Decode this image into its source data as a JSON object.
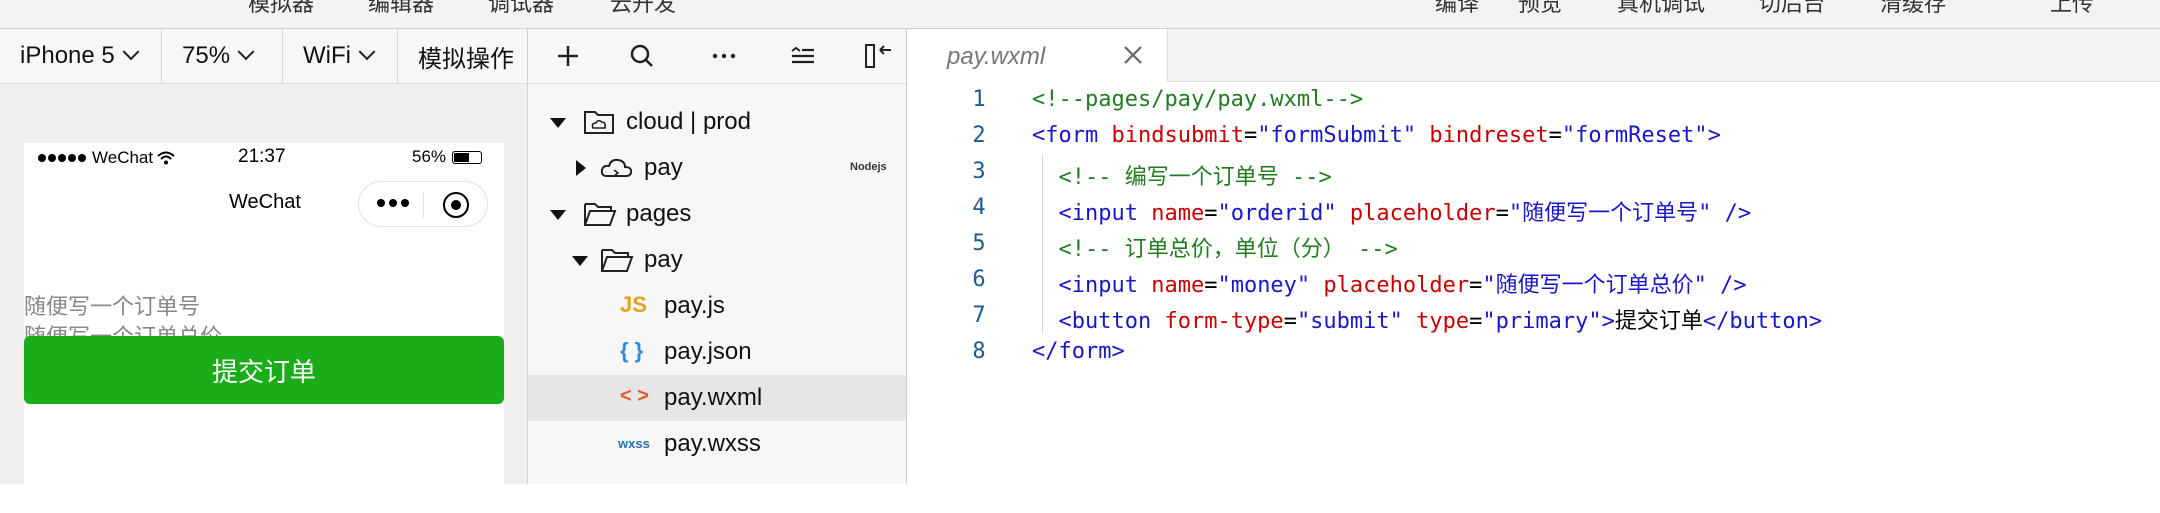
{
  "menubar": {
    "items": [
      "模拟器",
      "编辑器",
      "调试器",
      "云开发",
      "编译",
      "预览",
      "真机调试",
      "切后台",
      "清缓存",
      "上传"
    ]
  },
  "simulator": {
    "device": "iPhone 5",
    "zoom": "75%",
    "network": "WiFi",
    "operation": "模拟操作",
    "status": {
      "carrier": "WeChat",
      "time": "21:37",
      "battery": "56%",
      "battery_level": 0.56
    },
    "nav_title": "WeChat",
    "inputs": [
      "随便写一个订单号",
      "随便写一个订单总价"
    ],
    "submit_label": "提交订单"
  },
  "explorer": {
    "tree": [
      {
        "label": "cloud | prod",
        "depth": 0,
        "expanded": true,
        "icon": "cloud-folder-icon"
      },
      {
        "label": "pay",
        "depth": 1,
        "expanded": false,
        "icon": "cloud-function-icon",
        "badge": "Nodejs"
      },
      {
        "label": "pages",
        "depth": 0,
        "expanded": true,
        "icon": "folder-open-icon"
      },
      {
        "label": "pay",
        "depth": 1,
        "expanded": true,
        "icon": "folder-open-icon"
      },
      {
        "label": "pay.js",
        "depth": 2,
        "icon": "js-file-icon",
        "glyph": "JS"
      },
      {
        "label": "pay.json",
        "depth": 2,
        "icon": "json-file-icon",
        "glyph": "{ }"
      },
      {
        "label": "pay.wxml",
        "depth": 2,
        "icon": "wxml-file-icon",
        "glyph": "< >",
        "selected": true
      },
      {
        "label": "pay.wxss",
        "depth": 2,
        "icon": "wxss-file-icon",
        "glyph": "wxss"
      }
    ]
  },
  "editor": {
    "tab": "pay.wxml",
    "lines": [
      {
        "n": "1",
        "tokens": [
          [
            "c",
            "<!--pages/pay/pay.wxml-->"
          ]
        ]
      },
      {
        "n": "2",
        "tokens": [
          [
            "k",
            "<form "
          ],
          [
            "a",
            "bindsubmit"
          ],
          [
            "t",
            "="
          ],
          [
            "s",
            "\"formSubmit\""
          ],
          [
            "t",
            " "
          ],
          [
            "a",
            "bindreset"
          ],
          [
            "t",
            "="
          ],
          [
            "s",
            "\"formReset\""
          ],
          [
            "k",
            ">"
          ]
        ]
      },
      {
        "n": "3",
        "tokens": [
          [
            "t",
            "  "
          ],
          [
            "c",
            "<!-- 编写一个订单号 -->"
          ]
        ]
      },
      {
        "n": "4",
        "tokens": [
          [
            "t",
            "  "
          ],
          [
            "k",
            "<input "
          ],
          [
            "a",
            "name"
          ],
          [
            "t",
            "="
          ],
          [
            "s",
            "\"orderid\""
          ],
          [
            "t",
            " "
          ],
          [
            "a",
            "placeholder"
          ],
          [
            "t",
            "="
          ],
          [
            "s",
            "\"随便写一个订单号\""
          ],
          [
            "t",
            " "
          ],
          [
            "k",
            "/>"
          ]
        ]
      },
      {
        "n": "5",
        "tokens": [
          [
            "t",
            "  "
          ],
          [
            "c",
            "<!-- 订单总价，单位（分） -->"
          ]
        ]
      },
      {
        "n": "6",
        "tokens": [
          [
            "t",
            "  "
          ],
          [
            "k",
            "<input "
          ],
          [
            "a",
            "name"
          ],
          [
            "t",
            "="
          ],
          [
            "s",
            "\"money\""
          ],
          [
            "t",
            " "
          ],
          [
            "a",
            "placeholder"
          ],
          [
            "t",
            "="
          ],
          [
            "s",
            "\"随便写一个订单总价\""
          ],
          [
            "t",
            " "
          ],
          [
            "k",
            "/>"
          ]
        ]
      },
      {
        "n": "7",
        "tokens": [
          [
            "t",
            "  "
          ],
          [
            "k",
            "<button "
          ],
          [
            "a",
            "form-type"
          ],
          [
            "t",
            "="
          ],
          [
            "s",
            "\"submit\""
          ],
          [
            "t",
            " "
          ],
          [
            "a",
            "type"
          ],
          [
            "t",
            "="
          ],
          [
            "s",
            "\"primary\""
          ],
          [
            "k",
            ">"
          ],
          [
            "t",
            "提交订单"
          ],
          [
            "k",
            "</button>"
          ]
        ]
      },
      {
        "n": "8",
        "tokens": [
          [
            "k",
            "</form>"
          ]
        ]
      }
    ]
  },
  "colors": {
    "primary": "#1aad19",
    "comment": "#217c21",
    "tag": "#1717c9",
    "attr": "#c80000"
  }
}
